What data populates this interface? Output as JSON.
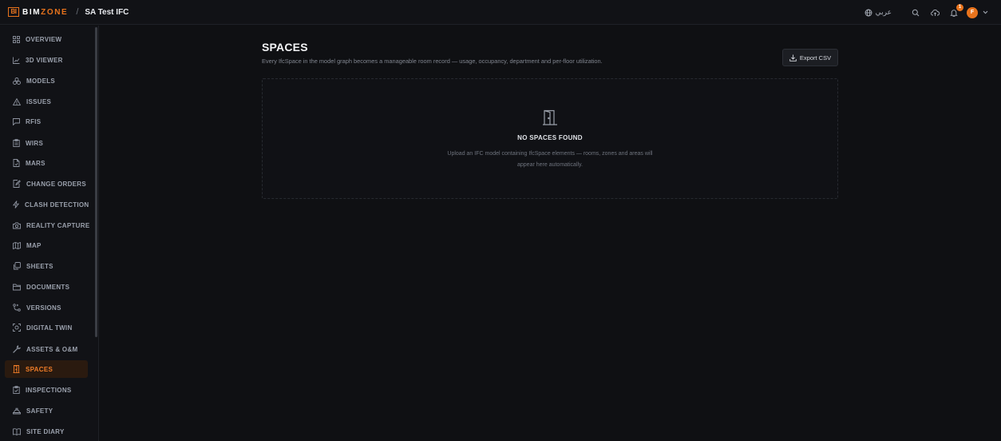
{
  "header": {
    "logo_mark": "BI",
    "brand_prefix": "BIM",
    "brand_suffix": "ZONE",
    "separator": "/",
    "project_name": "SA Test IFC",
    "language_label": "عربي",
    "notification_count": "1",
    "avatar_initial": "F"
  },
  "sidebar": {
    "items": [
      {
        "label": "OVERVIEW",
        "icon": "grid-icon"
      },
      {
        "label": "3D VIEWER",
        "icon": "chart-icon"
      },
      {
        "label": "MODELS",
        "icon": "cubes-icon"
      },
      {
        "label": "ISSUES",
        "icon": "warning-icon"
      },
      {
        "label": "RFIS",
        "icon": "message-icon"
      },
      {
        "label": "WIRS",
        "icon": "clipboard-icon"
      },
      {
        "label": "MARS",
        "icon": "file-icon"
      },
      {
        "label": "CHANGE ORDERS",
        "icon": "edit-file-icon"
      },
      {
        "label": "CLASH DETECTION",
        "icon": "lightning-icon"
      },
      {
        "label": "REALITY CAPTURE",
        "icon": "camera-icon"
      },
      {
        "label": "MAP",
        "icon": "map-icon"
      },
      {
        "label": "SHEETS",
        "icon": "sheets-icon"
      },
      {
        "label": "DOCUMENTS",
        "icon": "folder-icon"
      },
      {
        "label": "VERSIONS",
        "icon": "branch-icon"
      },
      {
        "label": "DIGITAL TWIN",
        "icon": "scan-icon"
      },
      {
        "label": "ASSETS & O&M",
        "icon": "wrench-icon"
      },
      {
        "label": "SPACES",
        "icon": "door-icon"
      },
      {
        "label": "INSPECTIONS",
        "icon": "checklist-icon"
      },
      {
        "label": "SAFETY",
        "icon": "hardhat-icon"
      },
      {
        "label": "SITE DIARY",
        "icon": "book-icon"
      }
    ],
    "active": "SPACES"
  },
  "main": {
    "title": "SPACES",
    "subtitle": "Every IfcSpace in the model graph becomes a manageable room record — usage, occupancy, department and per-floor utilization.",
    "export_label": "Export CSV",
    "empty_title": "NO SPACES FOUND",
    "empty_description": "Upload an IFC model containing IfcSpace elements — rooms, zones and areas will appear here automatically."
  },
  "colors": {
    "accent": "#e8731c",
    "background": "#0f1013",
    "sidebar": "#111216"
  }
}
